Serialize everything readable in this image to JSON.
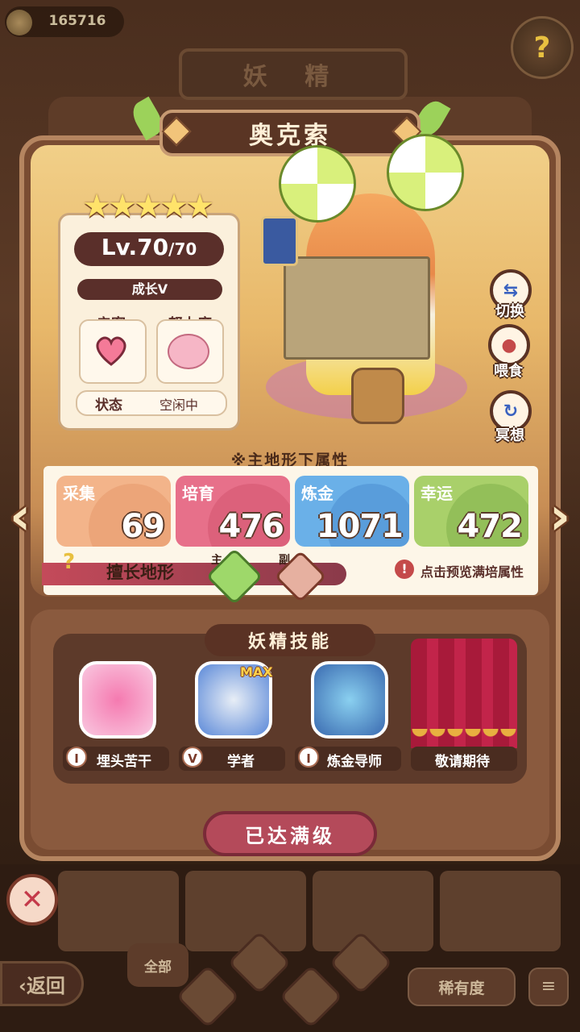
{
  "currency": {
    "value": "165716",
    "icon": "coin-icon"
  },
  "header": {
    "title": "妖 精",
    "help_icon": "question-icon"
  },
  "fairy": {
    "name": "奥克索",
    "stars": 5,
    "level": "Lv.70",
    "level_max": "/70",
    "growth": "成长V",
    "intimacy_label": "亲密",
    "effort_label": "努力度",
    "status_label": "状态",
    "status_value": "空闲中"
  },
  "actions": [
    {
      "label": "切换",
      "icon": "switch-icon"
    },
    {
      "label": "喂食",
      "icon": "meat-icon"
    },
    {
      "label": "冥想",
      "icon": "meditate-icon"
    }
  ],
  "attributes": {
    "heading": "※主地形下属性",
    "items": [
      {
        "label": "采集",
        "value": "69",
        "color": "#f3b48a"
      },
      {
        "label": "培育",
        "value": "476",
        "color": "#e7708a"
      },
      {
        "label": "炼金",
        "value": "1071",
        "color": "#6ab0e8"
      },
      {
        "label": "幸运",
        "value": "472",
        "color": "#a9d06a"
      }
    ],
    "terrain_label": "擅长地形",
    "terrain_main": "主",
    "terrain_sub": "副",
    "preview_text": "点击预览满培属性"
  },
  "skills": {
    "title": "妖精技能",
    "max_badge": "MAX",
    "items": [
      {
        "grade": "I",
        "label": "埋头苦干"
      },
      {
        "grade": "V",
        "label": "学者"
      },
      {
        "grade": "I",
        "label": "炼金导师"
      },
      {
        "grade": "",
        "label": "敬请期待"
      }
    ]
  },
  "maxed_button": "已达满级",
  "bottom": {
    "back_label": "‹返回",
    "filter_all": "全部",
    "rarity_label": "稀有度",
    "sort_icon": "sort-icon",
    "close_icon": "close-icon"
  },
  "colors": {
    "accent": "#b44a5a",
    "panel": "#7a4c32"
  }
}
